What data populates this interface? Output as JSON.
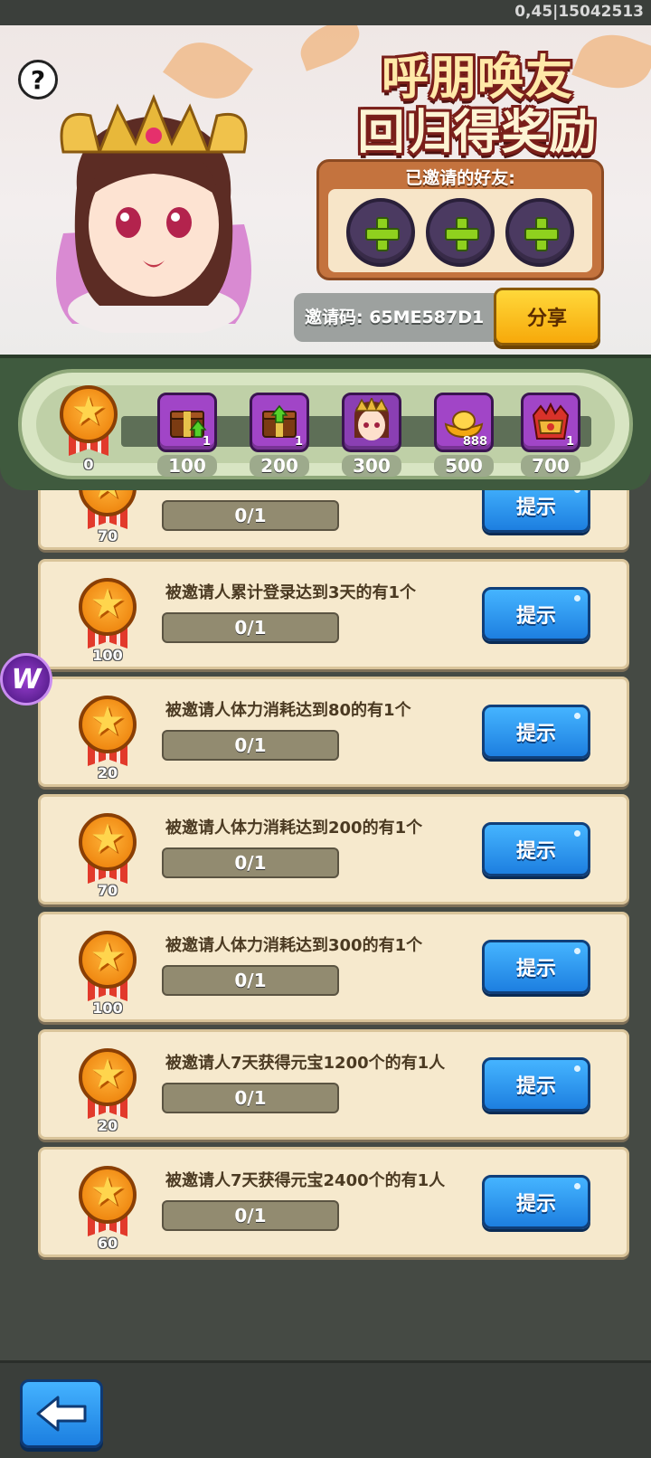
{
  "status": {
    "code": "0,45|15042513"
  },
  "header": {
    "title_line1": "呼朋唤友",
    "title_line2": "回归得奖励",
    "help_label": "?",
    "invited_label": "已邀请的好友:",
    "invite_code": "邀请码: 65ME587D1",
    "share_label": "分享"
  },
  "progress": {
    "current": "0",
    "milestones": [
      {
        "points": "100",
        "qty": "1",
        "icon": "gift-chest-upgrade-icon"
      },
      {
        "points": "200",
        "qty": "1",
        "icon": "gift-chest-upgrade-icon"
      },
      {
        "points": "300",
        "qty": "",
        "icon": "hero-portrait-icon"
      },
      {
        "points": "500",
        "qty": "888",
        "icon": "gold-ingot-icon"
      },
      {
        "points": "700",
        "qty": "1",
        "icon": "crown-armor-icon"
      }
    ]
  },
  "tasks": [
    {
      "desc": "",
      "progress": "0/1",
      "reward": "70",
      "hint": "提示"
    },
    {
      "desc": "被邀请人累计登录达到3天的有1个",
      "progress": "0/1",
      "reward": "100",
      "hint": "提示"
    },
    {
      "desc": "被邀请人体力消耗达到80的有1个",
      "progress": "0/1",
      "reward": "20",
      "hint": "提示"
    },
    {
      "desc": "被邀请人体力消耗达到200的有1个",
      "progress": "0/1",
      "reward": "70",
      "hint": "提示"
    },
    {
      "desc": "被邀请人体力消耗达到300的有1个",
      "progress": "0/1",
      "reward": "100",
      "hint": "提示"
    },
    {
      "desc": "被邀请人7天获得元宝1200个的有1人",
      "progress": "0/1",
      "reward": "20",
      "hint": "提示"
    },
    {
      "desc": "被邀请人7天获得元宝2400个的有1人",
      "progress": "0/1",
      "reward": "60",
      "hint": "提示"
    }
  ],
  "floating_badge": "W",
  "colors": {
    "panel_green": "#3f5a3e",
    "card_bg": "#f6e9cd",
    "hint_blue": "#1d7fe0",
    "share_yellow": "#ffd83a"
  }
}
